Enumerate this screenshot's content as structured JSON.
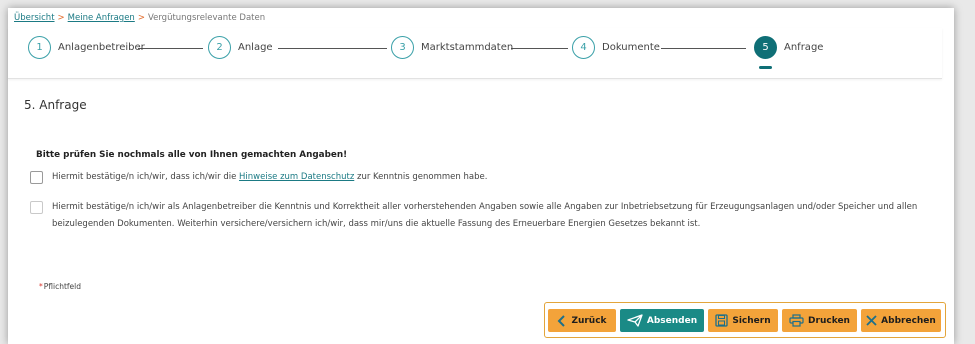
{
  "breadcrumb": {
    "items": [
      "Übersicht",
      "Meine Anfragen",
      "Vergütungsrelevante Daten"
    ],
    "separator": ">"
  },
  "stepper": {
    "steps": [
      {
        "number": "1",
        "label": "Anlagenbetreiber",
        "active": false
      },
      {
        "number": "2",
        "label": "Anlage",
        "active": false
      },
      {
        "number": "3",
        "label": "Marktstammdaten",
        "active": false
      },
      {
        "number": "4",
        "label": "Dokumente",
        "active": false
      },
      {
        "number": "5",
        "label": "Anfrage",
        "active": true
      }
    ]
  },
  "section": {
    "title": "5. Anfrage",
    "warning": "Bitte prüfen Sie nochmals alle von Ihnen gemachten Angaben!"
  },
  "checkboxes": [
    {
      "text_before": "Hiermit bestätige/n ich/wir, dass ich/wir die ",
      "link": "Hinweise zum Datenschutz",
      "text_after": " zur Kenntnis genommen habe.",
      "checked": false
    },
    {
      "text": "Hiermit bestätige/n ich/wir als Anlagenbetreiber die Kenntnis und Korrektheit aller vorherstehenden Angaben sowie alle Angaben zur Inbetriebsetzung für Erzeugungsanlagen und/oder Speicher und allen beizulegenden Dokumenten. Weiterhin versichere/versichern ich/wir, dass mir/uns die aktuelle Fassung des Erneuerbare Energien Gesetzes bekannt ist.",
      "checked": false
    }
  ],
  "required_note": {
    "star": "*",
    "label": "Pflichtfeld"
  },
  "buttons": {
    "back": "Zurück",
    "send": "Absenden",
    "save": "Sichern",
    "print": "Drucken",
    "cancel": "Abbrechen"
  },
  "colors": {
    "primary_teal": "#0f6f76",
    "accent_orange": "#f3a33a",
    "link": "#1b7a84"
  }
}
